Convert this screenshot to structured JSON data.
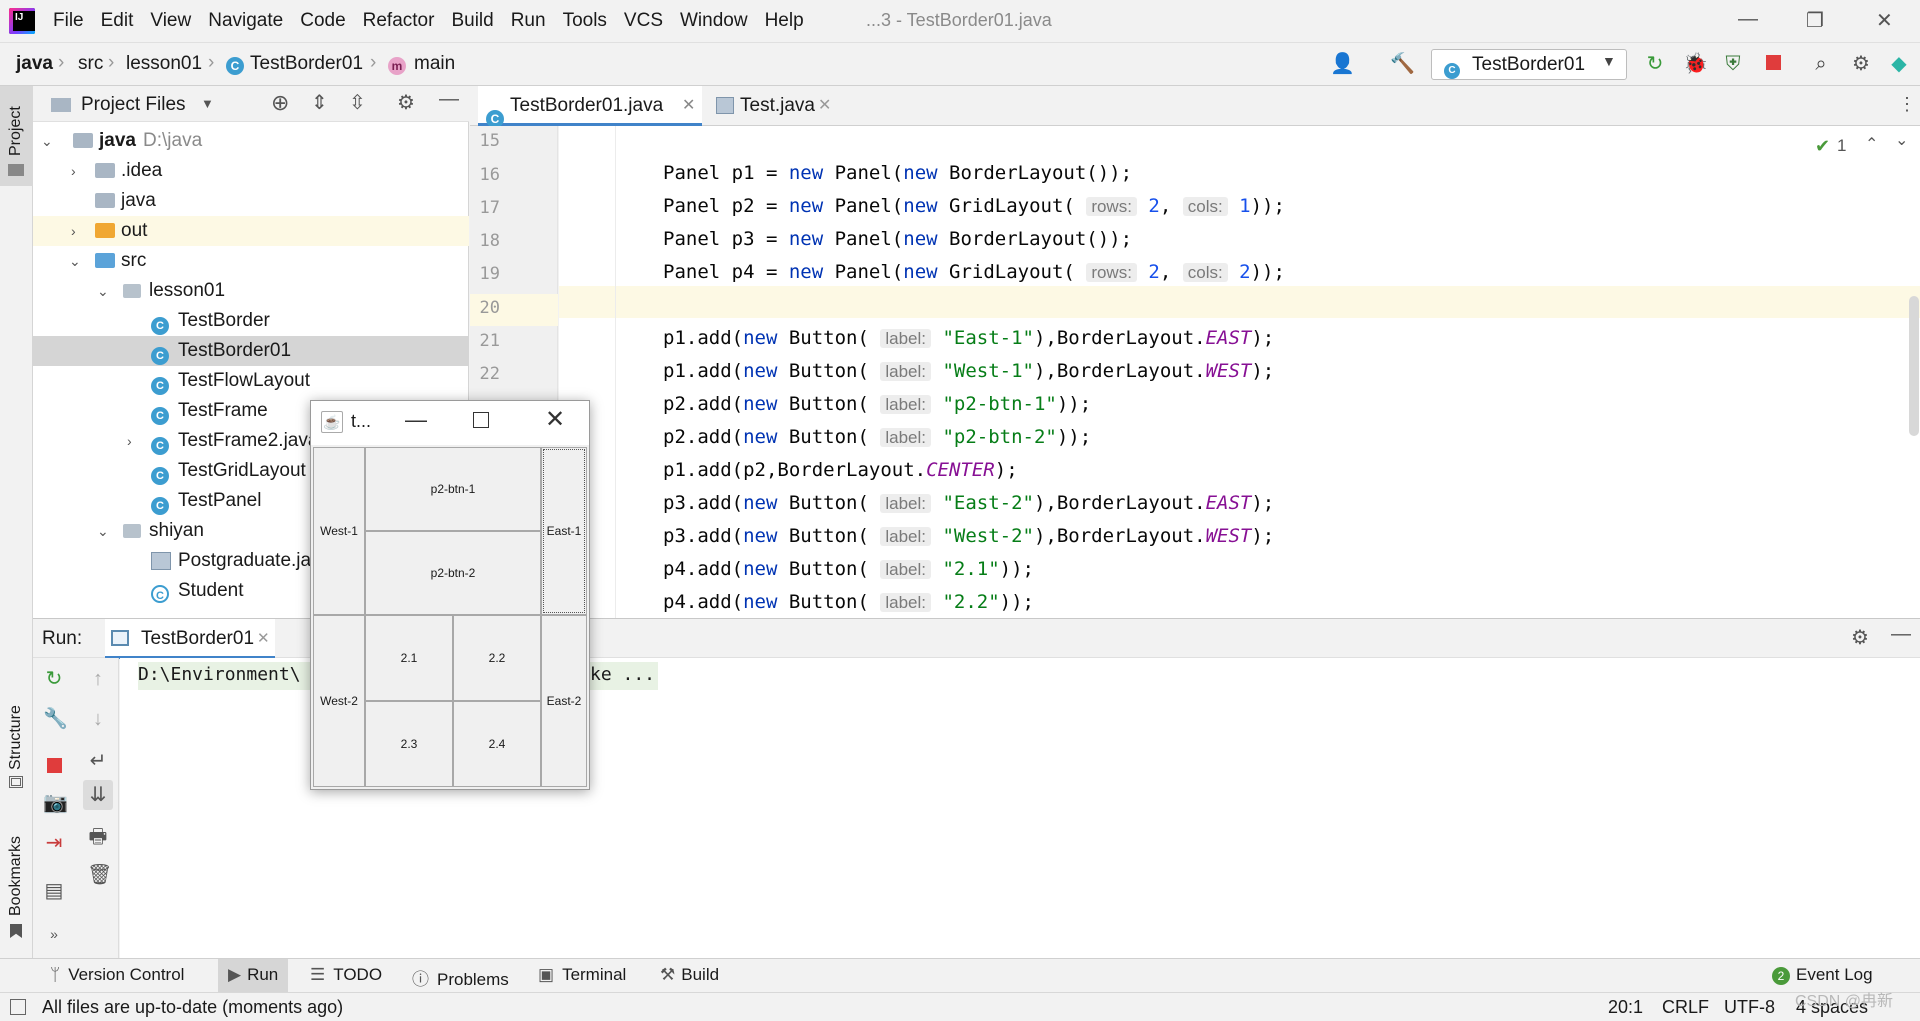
{
  "menubar": {
    "items": [
      "File",
      "Edit",
      "View",
      "Navigate",
      "Code",
      "Refactor",
      "Build",
      "Run",
      "Tools",
      "VCS",
      "Window",
      "Help"
    ],
    "title": "...3 - TestBorder01.java"
  },
  "navbar": {
    "crumbs": [
      "java",
      "src",
      "lesson01",
      "TestBorder01",
      "main"
    ],
    "run_config": "TestBorder01"
  },
  "left_stripe": {
    "project": "Project",
    "structure": "Structure",
    "bookmarks": "Bookmarks"
  },
  "project": {
    "header": "Project Files",
    "tree": [
      {
        "label": "java",
        "extra": "D:\\java"
      },
      {
        "label": ".idea"
      },
      {
        "label": "java"
      },
      {
        "label": "out"
      },
      {
        "label": "src"
      },
      {
        "label": "lesson01"
      },
      {
        "label": "TestBorder"
      },
      {
        "label": "TestBorder01"
      },
      {
        "label": "TestFlowLayout"
      },
      {
        "label": "TestFrame"
      },
      {
        "label": "TestFrame2.java"
      },
      {
        "label": "TestGridLayout"
      },
      {
        "label": "TestPanel"
      },
      {
        "label": "shiyan"
      },
      {
        "label": "Postgraduate.java"
      },
      {
        "label": "Student"
      }
    ]
  },
  "editor": {
    "tabs": [
      "TestBorder01.java",
      "Test.java"
    ],
    "line_numbers": [
      "15",
      "16",
      "17",
      "18",
      "19",
      "20",
      "21",
      "22"
    ],
    "inspection_count": "1",
    "hints": {
      "rows": "rows:",
      "cols": "cols:",
      "label": "label:"
    },
    "code": {
      "l16": {
        "a": "Panel p1 = ",
        "kw": "new",
        "b": " Panel(",
        "kw2": "new",
        "c": " BorderLayout());"
      },
      "l17": {
        "a": "Panel p2 = ",
        "kw": "new",
        "b": " Panel(",
        "kw2": "new",
        "c": " GridLayout(",
        "n1": "2",
        "sep": ", ",
        "n2": "1",
        "d": "));"
      },
      "l18": {
        "a": "Panel p3 = ",
        "kw": "new",
        "b": " Panel(",
        "kw2": "new",
        "c": " BorderLayout());"
      },
      "l19": {
        "a": "Panel p4 = ",
        "kw": "new",
        "b": " Panel(",
        "kw2": "new",
        "c": " GridLayout(",
        "n1": "2",
        "sep": ", ",
        "n2": "2",
        "d": "));"
      },
      "l21": {
        "a": "p1.add(",
        "kw": "new",
        "b": " Button(",
        "s": "\"East-1\"",
        "c": "),BorderLayout.",
        "k": "EAST",
        "d": ");"
      },
      "l22": {
        "a": "p1.add(",
        "kw": "new",
        "b": " Button(",
        "s": "\"West-1\"",
        "c": "),BorderLayout.",
        "k": "WEST",
        "d": ");"
      },
      "l23": {
        "a": "p2.add(",
        "kw": "new",
        "b": " Button(",
        "s": "\"p2-btn-1\"",
        "d": "));"
      },
      "l24": {
        "a": "p2.add(",
        "kw": "new",
        "b": " Button(",
        "s": "\"p2-btn-2\"",
        "d": "));"
      },
      "l25": {
        "a": "p1.add(p2,BorderLayout.",
        "k": "CENTER",
        "d": ");"
      },
      "l26": {
        "a": "p3.add(",
        "kw": "new",
        "b": " Button(",
        "s": "\"East-2\"",
        "c": "),BorderLayout.",
        "k": "EAST",
        "d": ");"
      },
      "l27": {
        "a": "p3.add(",
        "kw": "new",
        "b": " Button(",
        "s": "\"West-2\"",
        "c": "),BorderLayout.",
        "k": "WEST",
        "d": ");"
      },
      "l28": {
        "a": "p4.add(",
        "kw": "new",
        "b": " Button(",
        "s": "\"2.1\"",
        "d": "));"
      },
      "l29": {
        "a": "p4.add(",
        "kw": "new",
        "b": " Button(",
        "s": "\"2.2\"",
        "d": "));"
      }
    }
  },
  "run": {
    "label": "Run:",
    "tab": "TestBorder01",
    "console_left": "D:\\Environment\\",
    "console_right": "ke ..."
  },
  "swing": {
    "title": "t...",
    "buttons": {
      "west1": "West-1",
      "p2btn1": "p2-btn-1",
      "p2btn2": "p2-btn-2",
      "east1": "East-1",
      "west2": "West-2",
      "b21": "2.1",
      "b22": "2.2",
      "b23": "2.3",
      "b24": "2.4",
      "east2": "East-2"
    }
  },
  "bottom_tabs": [
    "Version Control",
    "Run",
    "TODO",
    "Problems",
    "Terminal",
    "Build"
  ],
  "event_log": {
    "count": "2",
    "label": "Event Log"
  },
  "status": {
    "message": "All files are up-to-date (moments ago)",
    "position": "20:1",
    "line_sep": "CRLF",
    "encoding": "UTF-8",
    "indent": "4 spaces",
    "watermark": "CSDN @冉新"
  },
  "colors": {
    "accent": "#4083c9",
    "keyword": "#0033b3",
    "string": "#067d17",
    "constant": "#871094",
    "number": "#1750eb"
  }
}
